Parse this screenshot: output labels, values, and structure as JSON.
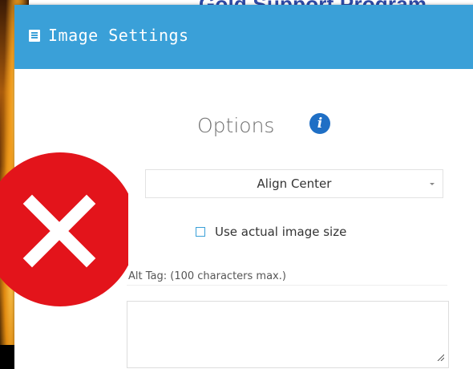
{
  "background": {
    "heading_text": "Gold Support Program"
  },
  "dialog": {
    "title": "Image Settings",
    "header_icon": "list-icon",
    "header_color": "#3aa0d8"
  },
  "options": {
    "title": "Options",
    "info_icon": "info-icon",
    "info_glyph": "i"
  },
  "align_select": {
    "selected": "Align Center"
  },
  "actual_size": {
    "label": "Use actual image size",
    "checked": false
  },
  "alt_tag": {
    "label": "Alt Tag: (100 characters max.)",
    "value": ""
  },
  "overlay": {
    "icon": "error-x-icon",
    "color": "#e3141b"
  }
}
